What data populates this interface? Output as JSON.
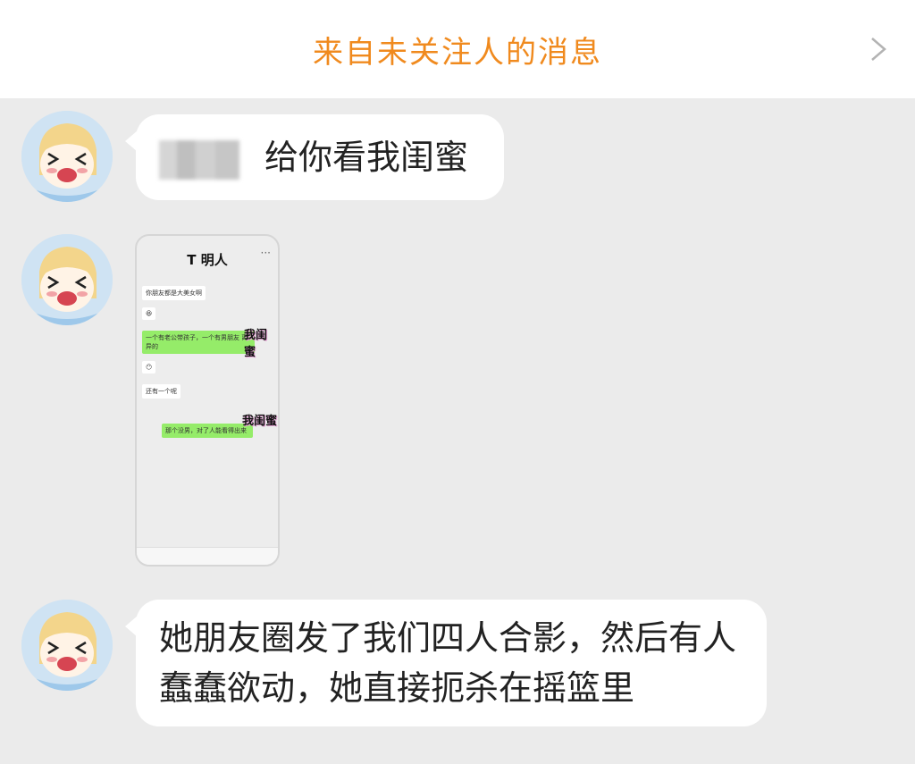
{
  "header": {
    "title": "来自未关注人的消息"
  },
  "messages": [
    {
      "type": "text",
      "sender_redacted": true,
      "text": "给你看我闺蜜"
    },
    {
      "type": "image",
      "phone": {
        "title": "T 明人",
        "menu": "···",
        "bubbles": [
          {
            "text": "你朋友都是大美女啊"
          },
          {
            "text": "😆"
          },
          {
            "text": "一个有老公带孩子，一个有男朋友 离异的"
          },
          {
            "text": "😶"
          },
          {
            "text": "还有一个呢"
          },
          {
            "text": "那个没男，对了人能看得出来"
          }
        ],
        "stamps": [
          "我闺蜜",
          "我闺蜜"
        ]
      }
    },
    {
      "type": "text",
      "text": "她朋友圈发了我们四人合影，然后有人蠢蠢欲动，她直接扼杀在摇篮里"
    }
  ],
  "colors": {
    "accent": "#f08a1e",
    "background": "#ebebeb",
    "bubble": "#ffffff",
    "green_bubble": "#95ec69"
  }
}
